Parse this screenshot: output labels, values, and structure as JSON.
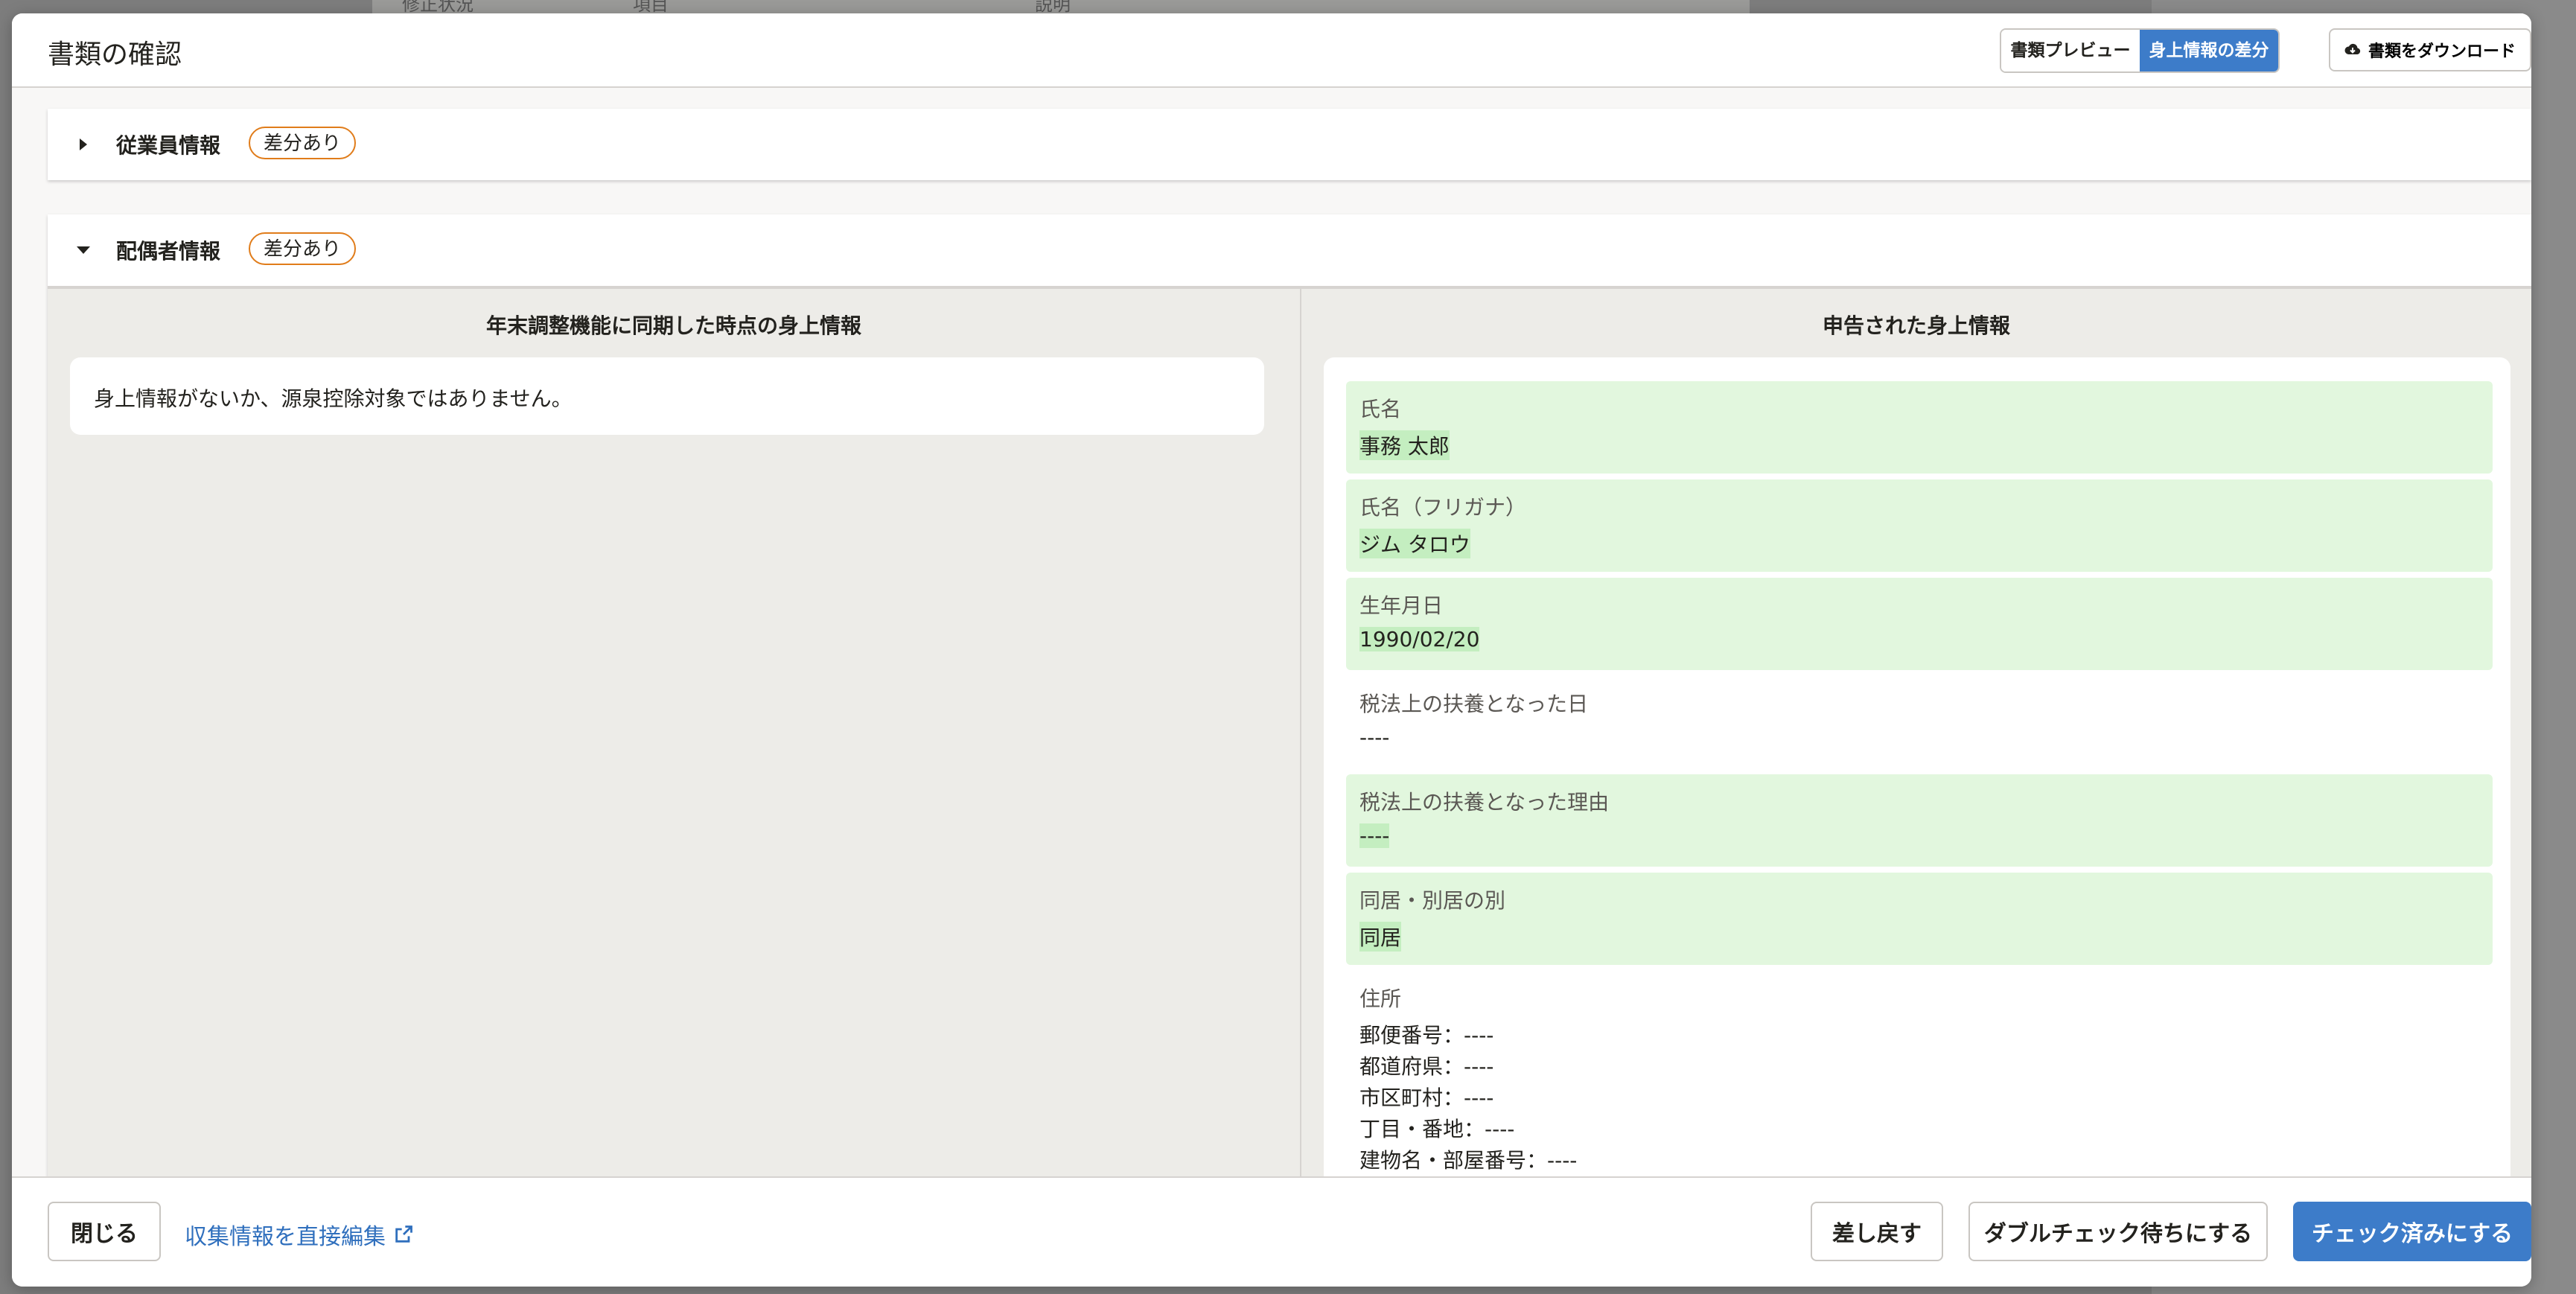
{
  "background": {
    "headers": [
      "修正状況",
      "項目",
      "説明"
    ]
  },
  "modal": {
    "title": "書類の確認",
    "view_tabs": [
      {
        "label": "書類プレビュー",
        "active": false
      },
      {
        "label": "身上情報の差分",
        "active": true
      }
    ],
    "download_label": "書類をダウンロード"
  },
  "sections": {
    "employee": {
      "title": "従業員情報",
      "badge": "差分あり",
      "expanded": false
    },
    "spouse": {
      "title": "配偶者情報",
      "badge": "差分あり",
      "expanded": true,
      "left_title": "年末調整機能に同期した時点の身上情報",
      "left_message": "身上情報がないか、源泉控除対象ではありません。",
      "right_title": "申告された身上情報",
      "fields": [
        {
          "label": "氏名",
          "value": "事務 太郎",
          "diff": true
        },
        {
          "label": "氏名（フリガナ）",
          "value": "ジム タロウ",
          "diff": true
        },
        {
          "label": "生年月日",
          "value": "1990/02/20",
          "diff": true
        },
        {
          "label": "税法上の扶養となった日",
          "value": "----",
          "diff": false
        },
        {
          "label": "税法上の扶養となった理由",
          "value": "----",
          "diff": true
        },
        {
          "label": "同居・別居の別",
          "value": "同居",
          "diff": true
        }
      ],
      "address": {
        "label": "住所",
        "lines": [
          "郵便番号：----",
          "都道府県：----",
          "市区町村：----",
          "丁目・番地：----",
          "建物名・部屋番号：----"
        ]
      }
    }
  },
  "footer": {
    "close_label": "閉じる",
    "edit_link_label": "収集情報を直接編集",
    "return_label": "差し戻す",
    "double_check_label": "ダブルチェック待ちにする",
    "checked_label": "チェック済みにする"
  },
  "colors": {
    "accent": "#3d7cc9",
    "diff_badge_border": "#e07c1a",
    "diff_bg": "#e2f7de",
    "diff_mark": "#c4eec0"
  }
}
